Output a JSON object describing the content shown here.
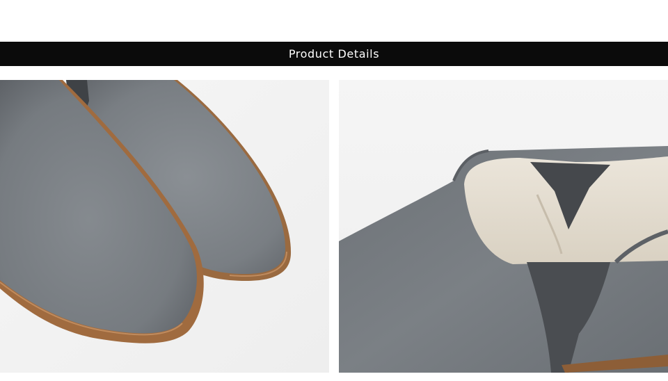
{
  "banner": {
    "title": "Product Details"
  },
  "photos": [
    {
      "subject": "suede-chelsea-boot-toes-pair"
    },
    {
      "subject": "suede-chelsea-boot-elastic-gusset"
    }
  ],
  "colors": {
    "banner_bg": "#0b0b0b",
    "banner_text": "#ffffff",
    "suede": "#767b80",
    "elastic": "#4a4d51",
    "lining": "#e4ddd0",
    "sole": "#a06b3f",
    "photo_bg": "#f3f3f3"
  }
}
